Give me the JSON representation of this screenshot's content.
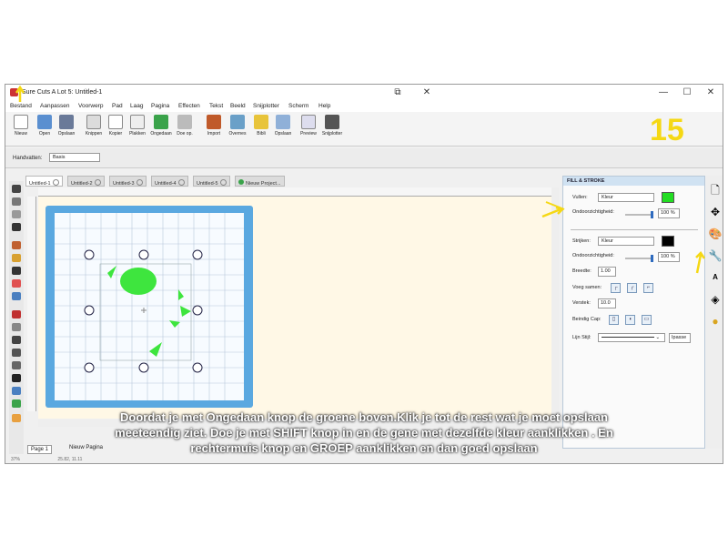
{
  "window": {
    "title": "Sure Cuts A Lot 5: Untitled-1",
    "restore_glyph": "⧉",
    "close_glyph": "✕",
    "minimize_glyph": "—",
    "maximize_glyph": "☐"
  },
  "menu": [
    "Bestand",
    "Aanpassen",
    "Voorwerp",
    "Pad",
    "Laag",
    "Pagina",
    "Effecten",
    "Tekst",
    "Beeld",
    "Snijplotter",
    "Scherm",
    "Help"
  ],
  "toolbar": [
    "Nieuw",
    "Open",
    "Opslaan",
    "Knippen",
    "Kopier",
    "Plakken",
    "Ongedaan",
    "Doe op.",
    "Import",
    "Overnes",
    "Bibli",
    "Opslaan",
    "Preview",
    "Snijplotter"
  ],
  "propbar": {
    "label": "Handvatten:",
    "value": "Basis"
  },
  "tabs": [
    "Untitled-1",
    "Untitled-2",
    "Untitled-3",
    "Untitled-4",
    "Untitled-5",
    "Nieuw Project..."
  ],
  "page_bar": {
    "page": "Page 1",
    "new_page": "Nieuw Pagina"
  },
  "status": {
    "zoom": "37%",
    "coords": "25.82, 11.11"
  },
  "panel": {
    "title": "FILL & STROKE",
    "fill_label": "Vullen:",
    "fill_type": "Kleur",
    "fill_color": "#22dd22",
    "fill_opacity_label": "Ondoorzichtigheid:",
    "fill_opacity": "100 %",
    "fill_opacity_level": 1.0,
    "stroke_label": "Strijken:",
    "stroke_type": "Kleur",
    "stroke_color": "#000000",
    "stroke_opacity_label": "Ondoorzichtigheid:",
    "stroke_opacity": "100 %",
    "width_label": "Breedte:",
    "width_value": "1.00",
    "join_label": "Voeg samen:",
    "miter_label": "Verstek:",
    "miter_value": "10.0",
    "cap_label": "Beindig Cap:",
    "line_label": "Lijn Stijl:",
    "dash_button": "Ipasse"
  },
  "caption": [
    "Doordat je met Ongedaan knop  de groene boven.Klik je tot de rest wat je moet opslaan",
    "meeteendig ziet. Doe je met SHIFT knop in en de gene  met dezelfde kleur aanklikken . En",
    "rechtermuis knop en GROEP aanklikken en dan goed opslaan"
  ],
  "annotation_number": "15",
  "accent": "#f5d814"
}
